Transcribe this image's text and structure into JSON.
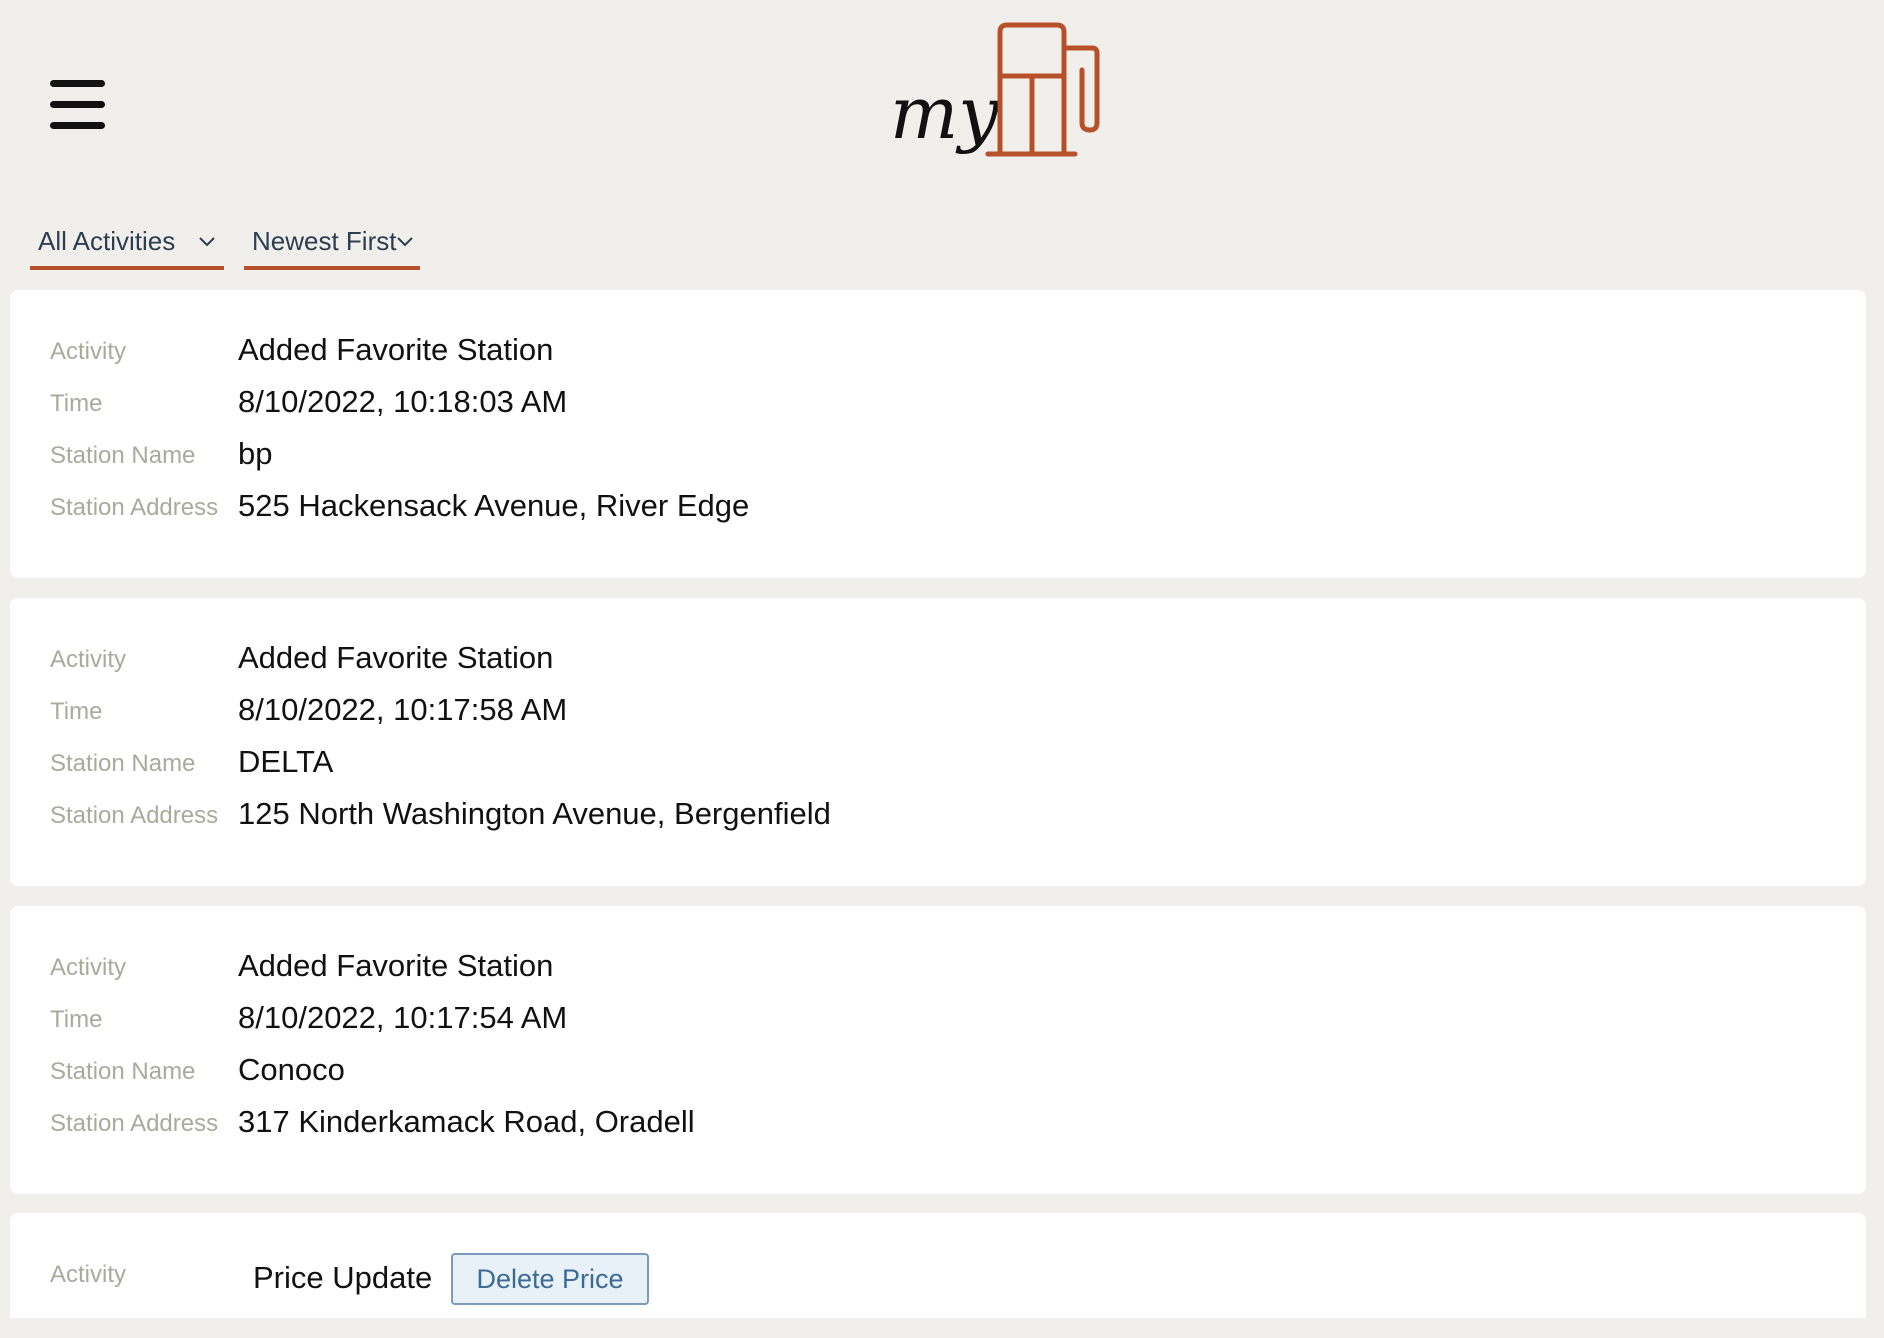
{
  "header": {
    "menu_icon": "hamburger-menu-icon",
    "logo": {
      "text": "my",
      "icon": "fuel-pump-icon",
      "accent_color": "#b8502a"
    }
  },
  "filters": {
    "activity_filter": "All Activities",
    "sort_order": "Newest First",
    "underline_color": "#b8502a"
  },
  "field_labels": {
    "activity": "Activity",
    "time": "Time",
    "station_name": "Station Name",
    "station_address": "Station Address"
  },
  "activities": [
    {
      "activity": "Added Favorite Station",
      "time": "8/10/2022, 10:18:03 AM",
      "station_name": "bp",
      "station_address": "525 Hackensack Avenue, River Edge"
    },
    {
      "activity": "Added Favorite Station",
      "time": "8/10/2022, 10:17:58 AM",
      "station_name": "DELTA",
      "station_address": "125 North Washington Avenue, Bergenfield"
    },
    {
      "activity": "Added Favorite Station",
      "time": "8/10/2022, 10:17:54 AM",
      "station_name": "Conoco",
      "station_address": "317 Kinderkamack Road, Oradell"
    },
    {
      "activity": "Price Update",
      "delete_label": "Delete Price"
    }
  ]
}
